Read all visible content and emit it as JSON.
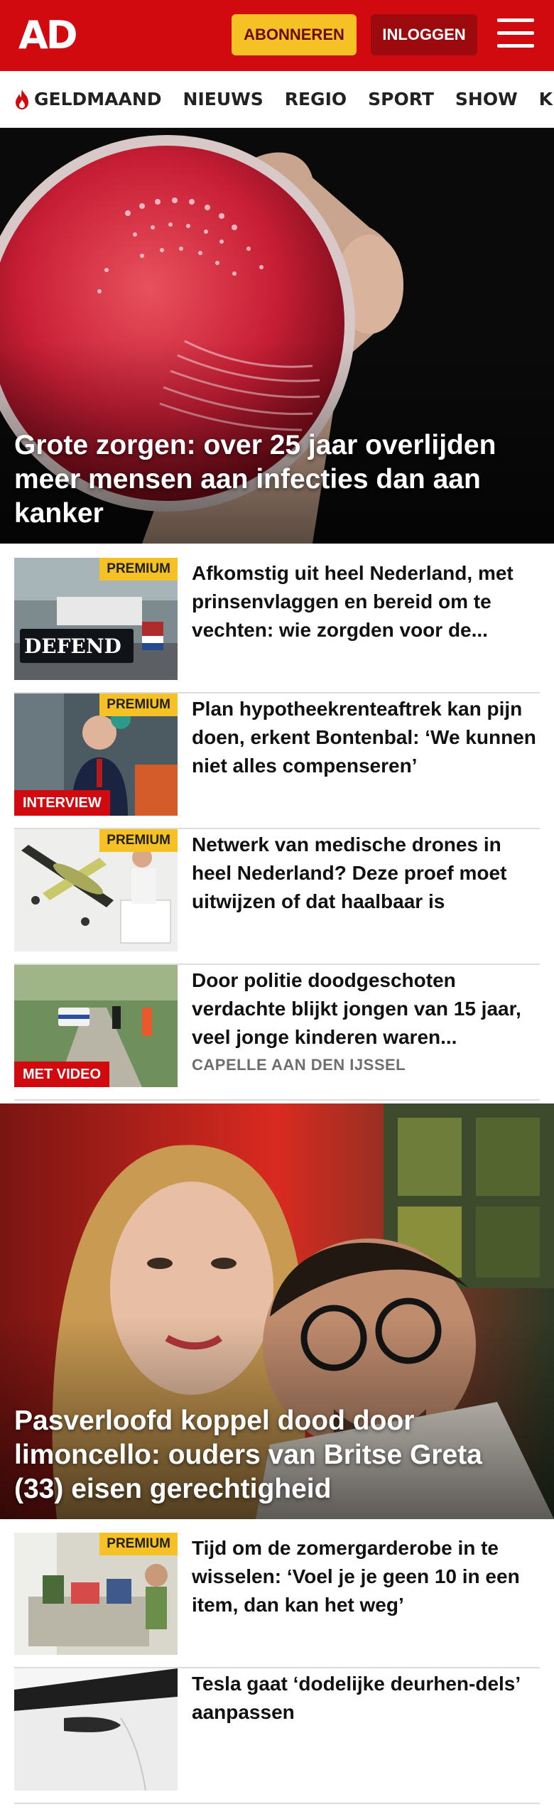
{
  "header": {
    "logo": "AD",
    "subscribe_label": "ABONNEREN",
    "login_label": "INLOGGEN",
    "menu_icon": "hamburger-menu-icon",
    "brand_color": "#d10a10"
  },
  "nav": {
    "items": [
      {
        "label": "GELDMAAND",
        "icon": "flame-icon"
      },
      {
        "label": "NIEUWS"
      },
      {
        "label": "REGIO"
      },
      {
        "label": "SPORT"
      },
      {
        "label": "SHOW"
      },
      {
        "label": "KIJK"
      }
    ]
  },
  "hero1": {
    "title": "Grote zorgen: over 25 jaar overlijden meer mensen aan infecties dan aan kanker"
  },
  "articles": [
    {
      "title": "Afkomstig uit heel Nederland, met prinsenvlaggen en bereid om te vechten: wie zorgden voor de...",
      "badge": "PREMIUM",
      "thumb_text": "DEFEND"
    },
    {
      "title": "Plan hypotheekrenteaftrek kan pijn doen, erkent Bontenbal: ‘We kunnen niet alles compenseren’",
      "badge": "PREMIUM",
      "label": "INTERVIEW"
    },
    {
      "title": "Netwerk van medische drones in heel Nederland? Deze proef moet uitwijzen of dat haalbaar is",
      "badge": "PREMIUM"
    },
    {
      "title": "Door politie doodgeschoten verdachte blijkt jongen van 15 jaar, veel jonge kinderen waren...",
      "label": "MET VIDEO",
      "meta": "CAPELLE AAN DEN IJSSEL"
    }
  ],
  "hero2": {
    "title": "Pasverloofd koppel dood door limoncello: ouders van Britse Greta (33) eisen gerechtigheid"
  },
  "articles2": [
    {
      "title": "Tijd om de zomergarderobe in te wisselen: ‘Voel je je geen 10 in een item, dan kan het weg’",
      "badge": "PREMIUM"
    },
    {
      "title": "Tesla gaat ‘dodelijke deurhen-dels’ aanpassen"
    }
  ]
}
